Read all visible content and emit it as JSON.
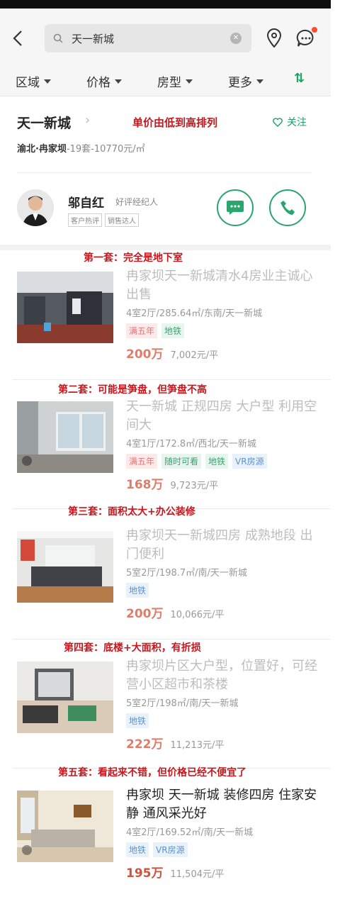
{
  "search": {
    "value": "天一新城"
  },
  "filters": [
    "区域",
    "价格",
    "房型",
    "更多"
  ],
  "sort_symbol": "⇅",
  "project": {
    "name": "天一新城",
    "sort_annotation": "单价由低到高排列",
    "follow_label": "关注",
    "area": "渝北·冉家坝",
    "summary": "-19套-10770元/㎡"
  },
  "agent": {
    "name": "邬自红",
    "tag": "好评经纪人",
    "badges": [
      "客户热评",
      "销售达人"
    ]
  },
  "listings": [
    {
      "annotation": "第一套：完全是地下室",
      "title": "冉家坝天一新城清水4房业主诚心出售",
      "meta": "4室2厅/285.64㎡/东南/天一新城",
      "tags": [
        {
          "text": "满五年",
          "color": "red"
        },
        {
          "text": "地铁",
          "color": "green"
        }
      ],
      "price": "200万",
      "unit_price": "7,002元/平"
    },
    {
      "annotation": "第二套：可能是笋盘，但笋盘不高",
      "title": "天一新城 正规四房 大户型 利用空间大",
      "meta": "4室1厅/172.8㎡/西北/天一新城",
      "tags": [
        {
          "text": "满五年",
          "color": "red"
        },
        {
          "text": "随时可看",
          "color": "green"
        },
        {
          "text": "地铁",
          "color": "green"
        },
        {
          "text": "VR房源",
          "color": "blue"
        }
      ],
      "price": "168万",
      "unit_price": "9,723元/平"
    },
    {
      "annotation": "第三套：面积太大+办公装修",
      "title": "冉家坝天一新城四房 成熟地段 出门便利",
      "meta": "5室2厅/198.7㎡/南/天一新城",
      "tags": [
        {
          "text": "地铁",
          "color": "blue"
        }
      ],
      "price": "200万",
      "unit_price": "10,066元/平"
    },
    {
      "annotation": "第四套：底楼+大面积，有折损",
      "title": "冉家坝片区大户型，位置好，可经营小区超市和茶楼",
      "meta": "5室2厅/198㎡/南/天一新城",
      "tags": [
        {
          "text": "地铁",
          "color": "blue"
        }
      ],
      "price": "222万",
      "unit_price": "11,213元/平"
    },
    {
      "annotation": "第五套：看起来不错，但价格已经不便宜了",
      "title": "冉家坝 天一新城 装修四房 住家安静 通风采光好",
      "meta": "4室2厅/169.52㎡/南/天一新城",
      "tags": [
        {
          "text": "地铁",
          "color": "blue"
        },
        {
          "text": "VR房源",
          "color": "blue"
        }
      ],
      "price": "195万",
      "unit_price": "11,504元/平"
    }
  ]
}
